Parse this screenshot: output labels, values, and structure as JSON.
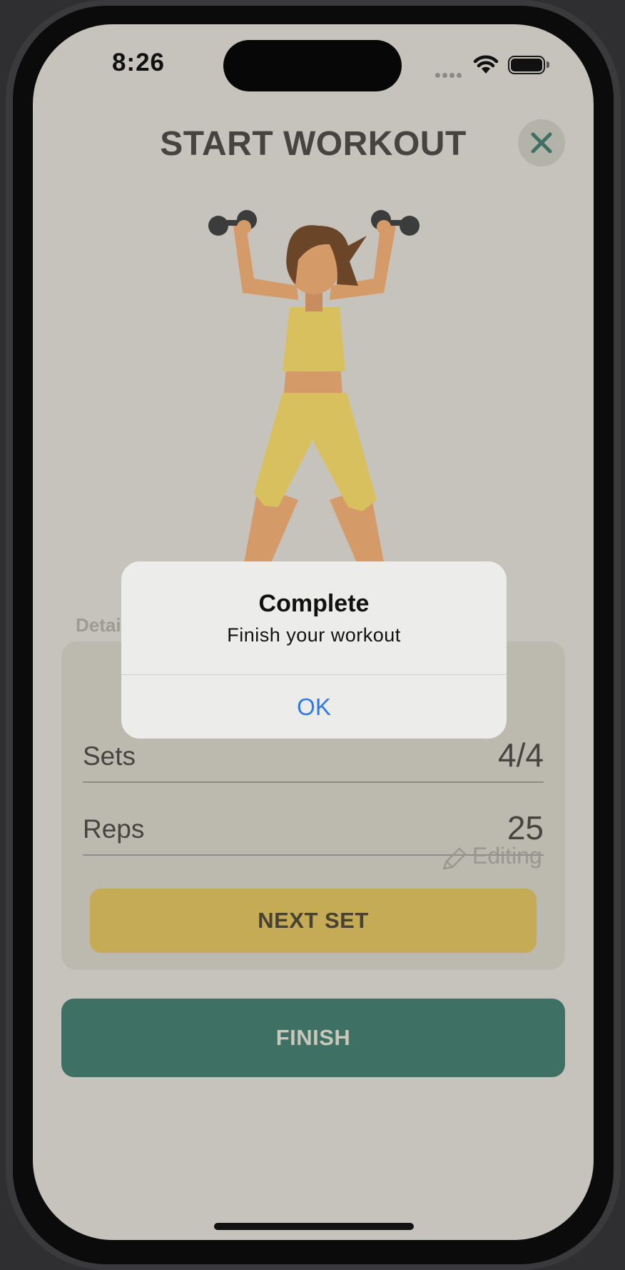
{
  "status_bar": {
    "time": "8:26"
  },
  "header": {
    "title": "START WORKOUT",
    "close_icon": "close-x-icon"
  },
  "details": {
    "label": "Details",
    "sets": {
      "label": "Sets",
      "value": "4/4"
    },
    "reps": {
      "label": "Reps",
      "value": "25"
    },
    "editing_label": "Editing",
    "next_set_label": "NEXT SET"
  },
  "finish_label": "FINISH",
  "alert": {
    "title": "Complete",
    "message": "Finish your workout",
    "ok_label": "OK"
  },
  "colors": {
    "teal": "#3e7163",
    "gold": "#c5ab55",
    "link_blue": "#2f7ae5"
  }
}
